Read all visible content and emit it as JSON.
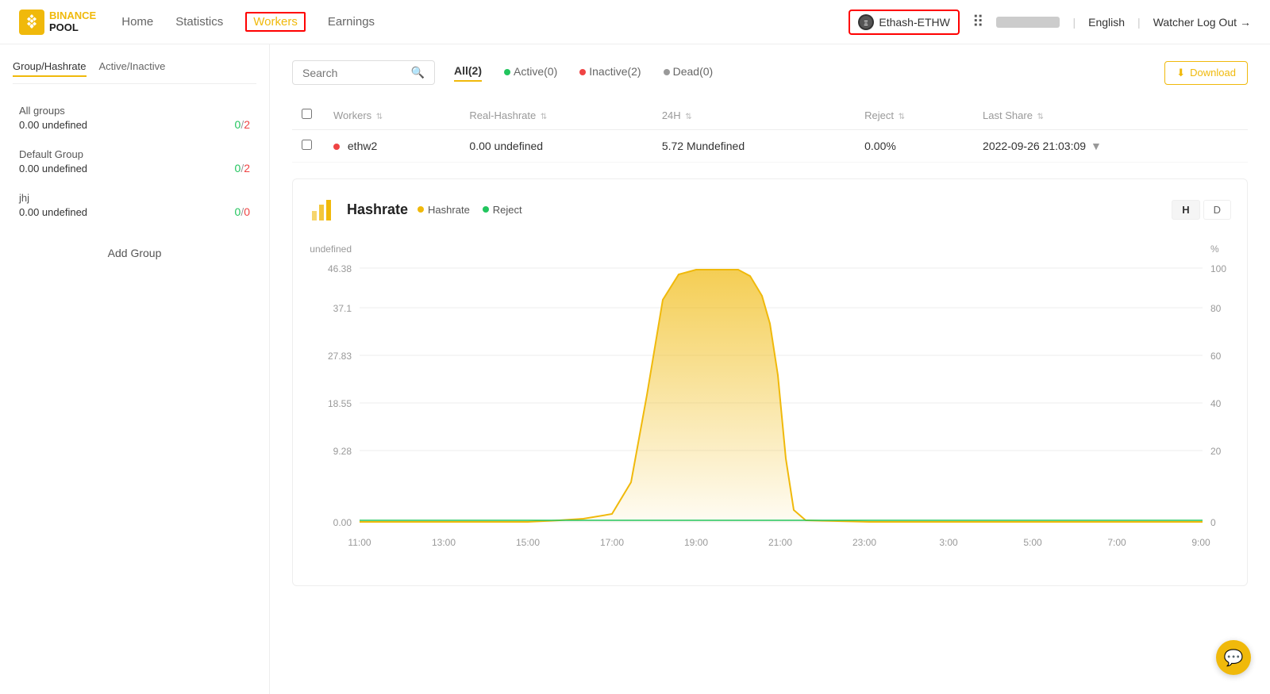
{
  "header": {
    "logo_binance": "BINANCE",
    "logo_pool": "POOL",
    "nav_items": [
      {
        "label": "Home",
        "active": false
      },
      {
        "label": "Statistics",
        "active": false
      },
      {
        "label": "Workers",
        "active": true
      },
      {
        "label": "Earnings",
        "active": false
      }
    ],
    "coin_selector": "Ethash-ETHW",
    "language": "English",
    "watcher_logout": "Watcher Log Out"
  },
  "sidebar": {
    "tab1": "Group/Hashrate",
    "tab2": "Active/Inactive",
    "groups": [
      {
        "name": "All groups",
        "hashrate": "0.00 undefined",
        "active": "0",
        "total": "2"
      },
      {
        "name": "Default Group",
        "hashrate": "0.00 undefined",
        "active": "0",
        "total": "2"
      },
      {
        "name": "jhj",
        "hashrate": "0.00 undefined",
        "active": "0",
        "total": "0"
      }
    ],
    "add_group": "Add Group"
  },
  "filter": {
    "search_placeholder": "Search",
    "tabs": [
      {
        "label": "All(2)",
        "active": true
      },
      {
        "label": "Active(0)",
        "dot": "green",
        "active": false
      },
      {
        "label": "Inactive(2)",
        "dot": "red",
        "active": false
      },
      {
        "label": "Dead(0)",
        "dot": "gray",
        "active": false
      }
    ],
    "download": "Download"
  },
  "table": {
    "headers": [
      "Workers",
      "Real-Hashrate",
      "24H",
      "Reject",
      "Last Share"
    ],
    "rows": [
      {
        "worker": "ethw2",
        "status": "inactive",
        "real_hashrate": "0.00 undefined",
        "h24": "5.72 Mundefined",
        "reject": "0.00%",
        "last_share": "2022-09-26 21:03:09"
      }
    ]
  },
  "chart": {
    "title": "Hashrate",
    "legend_hashrate": "Hashrate",
    "legend_reject": "Reject",
    "y_axis_unit": "undefined",
    "y_axis_labels": [
      "46.38",
      "37.1",
      "27.83",
      "18.55",
      "9.28",
      "0.00"
    ],
    "y_axis_right": [
      "100",
      "80",
      "60",
      "40",
      "20",
      "0"
    ],
    "percent_label": "%",
    "x_axis_labels": [
      "11:00",
      "13:00",
      "15:00",
      "17:00",
      "19:00",
      "21:00",
      "23:00",
      "3:00",
      "5:00",
      "7:00",
      "9:00"
    ],
    "btn_h": "H",
    "btn_d": "D",
    "active_btn": "H"
  }
}
